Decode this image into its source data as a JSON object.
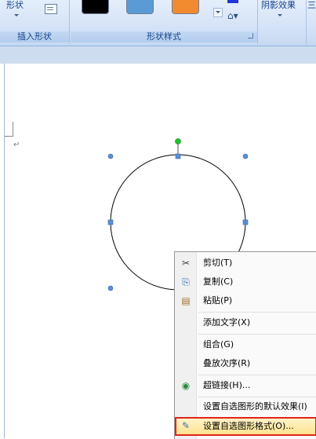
{
  "ribbon": {
    "groups": [
      {
        "label": "插入形状",
        "shape_button": "形状"
      },
      {
        "label": "形状样式"
      },
      {
        "label": "",
        "shadow_button": "阴影效果"
      },
      {
        "label": "",
        "partial_text": "三"
      }
    ],
    "swatch_colors": [
      "#000000",
      "#5b9bd5",
      "#f28b30"
    ],
    "fill_color": "#1f34d8"
  },
  "document": {
    "paragraph_mark": "↵"
  },
  "shape": {
    "type": "circle",
    "stroke": "#000000",
    "handle_color": "#5b8fd4",
    "rotate_handle_color": "#22c22a"
  },
  "context_menu": {
    "items": [
      {
        "label": "剪切(T)",
        "icon": "scissors-icon",
        "glyph": "✂"
      },
      {
        "label": "复制(C)",
        "icon": "copy-icon",
        "glyph": "⎘"
      },
      {
        "label": "粘贴(P)",
        "icon": "paste-icon",
        "glyph": "📋"
      },
      {
        "label": "添加文字(X)"
      },
      {
        "label": "组合(G)"
      },
      {
        "label": "叠放次序(R)"
      },
      {
        "label": "超链接(H)...",
        "icon": "hyperlink-icon",
        "glyph": "🌐"
      },
      {
        "label": "设置自选图形的默认效果(I)"
      },
      {
        "label": "设置自选图形格式(O)...",
        "icon": "format-shape-icon",
        "glyph": "🖌",
        "highlighted": true
      }
    ],
    "highlight_border": "#e2231a"
  }
}
